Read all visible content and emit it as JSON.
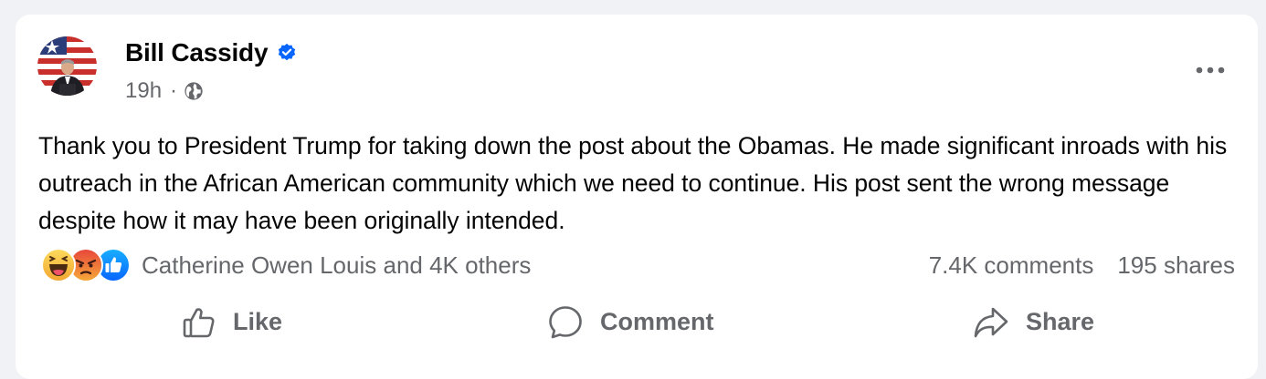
{
  "post": {
    "author": "Bill Cassidy",
    "time": "19h",
    "separator": "·",
    "audience_icon": "globe-icon",
    "verified_icon": "verified-badge-icon",
    "more_icon": "more-options-icon",
    "text": "Thank you to President Trump for taking down the post about the Obamas. He made significant inroads with his outreach in the African American community which we need to continue. His post sent the wrong message despite how it may have been originally intended."
  },
  "engagement": {
    "reaction_icons": [
      "haha-reaction-icon",
      "angry-reaction-icon",
      "like-reaction-icon"
    ],
    "reactions_summary": "Catherine Owen Louis and 4K others",
    "comments": "7.4K comments",
    "shares": "195 shares"
  },
  "actions": {
    "like": "Like",
    "comment": "Comment",
    "share": "Share"
  },
  "colors": {
    "page_bg": "#f0f2f5",
    "card_bg": "#ffffff",
    "secondary_text": "#65676b",
    "verified_blue": "#0866ff",
    "like_blue": "#0866ff",
    "angry_red": "#f06c3b",
    "haha_yellow": "#f7c93c"
  }
}
